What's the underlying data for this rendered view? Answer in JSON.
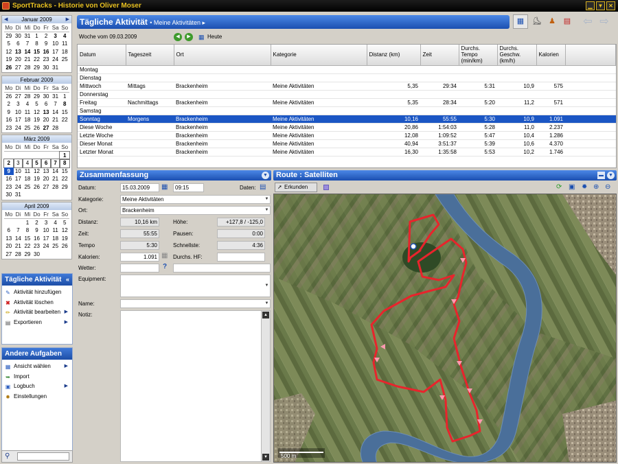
{
  "window": {
    "title": "SportTracks - Historie von Oliver Moser"
  },
  "calendars": [
    {
      "month": "Januar 2009",
      "weekdays": [
        "Mo",
        "Di",
        "Mi",
        "Do",
        "Fr",
        "Sa",
        "So"
      ],
      "cells": [
        "29",
        "30",
        "31",
        "1",
        "2",
        "3",
        "4",
        "5",
        "6",
        "7",
        "8",
        "9",
        "10",
        "11",
        "12",
        "13",
        "14",
        "15",
        "16",
        "17",
        "18",
        "19",
        "20",
        "21",
        "22",
        "23",
        "24",
        "25",
        "26",
        "27",
        "28",
        "29",
        "30",
        "31",
        ""
      ],
      "bold": [
        5,
        6,
        15,
        16,
        17,
        18,
        28
      ]
    },
    {
      "month": "Februar 2009",
      "weekdays": [
        "Mo",
        "Di",
        "Mi",
        "Do",
        "Fr",
        "Sa",
        "So"
      ],
      "cells": [
        "26",
        "27",
        "28",
        "29",
        "30",
        "31",
        "1",
        "2",
        "3",
        "4",
        "5",
        "6",
        "7",
        "8",
        "9",
        "10",
        "11",
        "12",
        "13",
        "14",
        "15",
        "16",
        "17",
        "18",
        "19",
        "20",
        "21",
        "22",
        "23",
        "24",
        "25",
        "26",
        "27",
        "28",
        ""
      ],
      "bold": [
        13,
        18,
        32
      ]
    },
    {
      "month": "März 2009",
      "weekdays": [
        "Mo",
        "Di",
        "Mi",
        "Do",
        "Fr",
        "Sa",
        "So"
      ],
      "cells": [
        "",
        "",
        "",
        "",
        "",
        "",
        "1",
        "2",
        "3",
        "4",
        "5",
        "6",
        "7",
        "8",
        "9",
        "10",
        "11",
        "12",
        "13",
        "14",
        "15",
        "16",
        "17",
        "18",
        "19",
        "20",
        "21",
        "22",
        "23",
        "24",
        "25",
        "26",
        "27",
        "28",
        "29",
        "30",
        "31"
      ],
      "bold": [
        6,
        7,
        10,
        11,
        12,
        13,
        14
      ],
      "boxed": [
        6,
        7,
        8,
        9,
        10,
        11,
        12,
        13
      ],
      "selected": 14
    },
    {
      "month": "April 2009",
      "weekdays": [
        "Mo",
        "Di",
        "Mi",
        "Do",
        "Fr",
        "Sa",
        "So"
      ],
      "cells": [
        "",
        "",
        "1",
        "2",
        "3",
        "4",
        "5",
        "6",
        "7",
        "8",
        "9",
        "10",
        "11",
        "12",
        "13",
        "14",
        "15",
        "16",
        "17",
        "18",
        "19",
        "20",
        "21",
        "22",
        "23",
        "24",
        "25",
        "26",
        "27",
        "28",
        "29",
        "30",
        "",
        "",
        ""
      ],
      "bold": []
    }
  ],
  "tasks": {
    "title": "Tägliche Aktivität",
    "items": [
      "Aktivität hinzufügen",
      "Aktivität löschen",
      "Aktivität bearbeiten",
      "Exportieren"
    ]
  },
  "other_tasks": {
    "title": "Andere Aufgaben",
    "items": [
      "Ansicht wählen",
      "Import",
      "Logbuch",
      "Einstellungen"
    ]
  },
  "main": {
    "title": "Tägliche Aktivität",
    "subtitle": "Meine Aktivitäten",
    "week_label": "Woche vom 09.03.2009",
    "today_label": "Heute"
  },
  "grid": {
    "columns": [
      "Datum",
      "Tageszeit",
      "Ort",
      "Kategorie",
      "Distanz (km)",
      "Zeit",
      "Durchs. Tempo (min/km)",
      "Durchs. Geschw. (km/h)",
      "Kalorien"
    ],
    "rows": [
      [
        "Montag",
        "",
        "",
        "",
        "",
        "",
        "",
        "",
        ""
      ],
      [
        "Dienstag",
        "",
        "",
        "",
        "",
        "",
        "",
        "",
        ""
      ],
      [
        "Mittwoch",
        "Mittags",
        "Brackenheim",
        "Meine Aktivitäten",
        "5,35",
        "29:34",
        "5:31",
        "10,9",
        "575"
      ],
      [
        "Donnerstag",
        "",
        "",
        "",
        "",
        "",
        "",
        "",
        ""
      ],
      [
        "Freitag",
        "Nachmittags",
        "Brackenheim",
        "Meine Aktivitäten",
        "5,35",
        "28:34",
        "5:20",
        "11,2",
        "571"
      ],
      [
        "Samstag",
        "",
        "",
        "",
        "",
        "",
        "",
        "",
        ""
      ],
      [
        "Sonntag",
        "Morgens",
        "Brackenheim",
        "Meine Aktivitäten",
        "10,16",
        "55:55",
        "5:30",
        "10,9",
        "1.091"
      ],
      [
        "Diese Woche",
        "",
        "Brackenheim",
        "Meine Aktivitäten",
        "20,86",
        "1:54:03",
        "5:28",
        "11,0",
        "2.237"
      ],
      [
        "Letzte Woche",
        "",
        "Brackenheim",
        "Meine Aktivitäten",
        "12,08",
        "1:09:52",
        "5:47",
        "10,4",
        "1.286"
      ],
      [
        "Dieser Monat",
        "",
        "Brackenheim",
        "Meine Aktivitäten",
        "40,94",
        "3:51:37",
        "5:39",
        "10,6",
        "4.370"
      ],
      [
        "Letzter Monat",
        "",
        "Brackenheim",
        "Meine Aktivitäten",
        "16,30",
        "1:35:58",
        "5:53",
        "10,2",
        "1.746"
      ]
    ],
    "selected_row": 6
  },
  "summary": {
    "title": "Zusammenfassung",
    "datum_label": "Datum:",
    "datum": "15.03.2009",
    "time": "09:15",
    "daten_label": "Daten:",
    "kategorie_label": "Kategorie:",
    "kategorie": "Meine Aktivitäten",
    "ort_label": "Ort:",
    "ort": "Brackenheim",
    "distanz_label": "Distanz:",
    "distanz": "10,16 km",
    "hoehe_label": "Höhe:",
    "hoehe": "+127,8 / -125,0",
    "zeit_label": "Zeit:",
    "zeit": "55:55",
    "pausen_label": "Pausen:",
    "pausen": "0:00",
    "tempo_label": "Tempo",
    "tempo": "5:30",
    "schnellste_label": "Schnellste:",
    "schnellste": "4:36",
    "kalorien_label": "Kalorien:",
    "kalorien": "1.091",
    "hf_label": "Durchs. HF:",
    "hf": "",
    "wetter_label": "Wetter:",
    "wetter": "",
    "equipment_label": "Equipment:",
    "name_label": "Name:",
    "name": "",
    "notiz_label": "Notiz:"
  },
  "route": {
    "title": "Route : Satelliten",
    "explore_label": "Erkunden",
    "scale_label": "500 m"
  },
  "colors": {
    "header_blue": "#1b4fb0",
    "selection": "#1b56c4",
    "route": "#e8242c",
    "river": "#4a6f9a"
  }
}
